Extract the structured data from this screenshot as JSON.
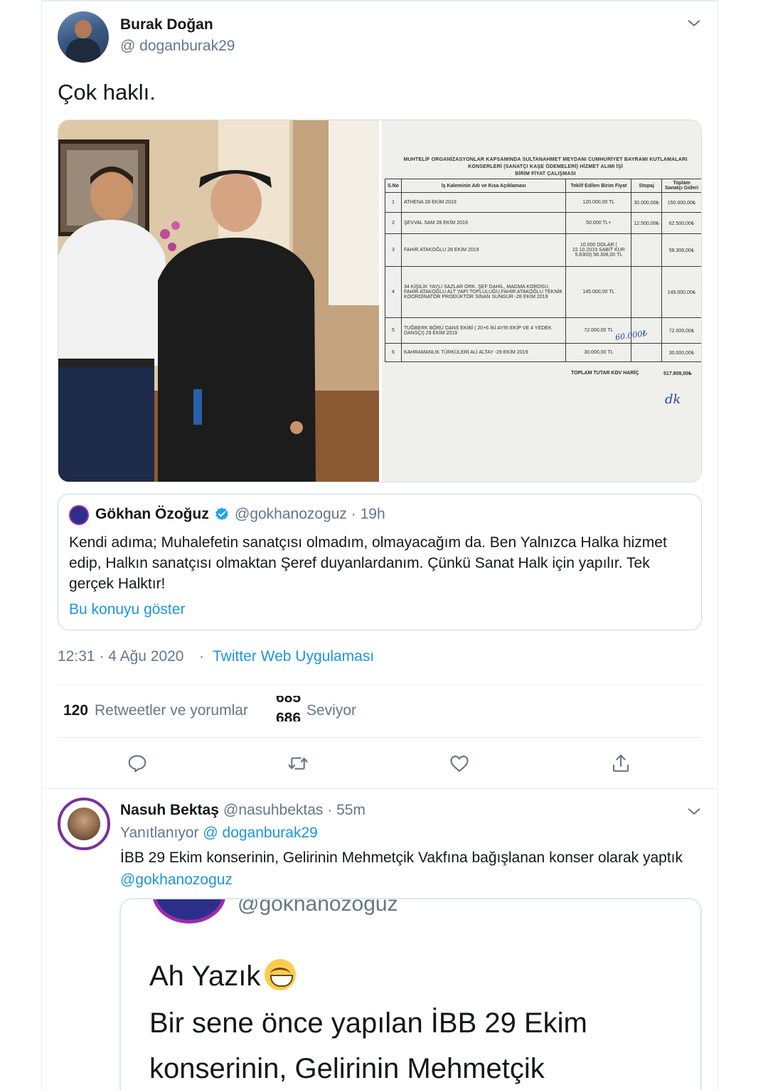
{
  "main_tweet": {
    "author_name": "Burak Doğan",
    "author_handle": "@ doganburak29",
    "text": "Çok haklı.",
    "timestamp": "12:31 · 4 Ağu 2020",
    "meta_separator": "·",
    "source": "Twitter Web Uygulaması"
  },
  "document": {
    "title_lines": [
      "MUHTELİF ORGANİZASYONLAR KAPSAMINDA SULTANAHMET MEYDANI CUMHURİYET BAYRAMI KUTLAMALARI",
      "KONSERLERİ (SANATÇI KAŞE ÖDEMELERİ) HİZMET ALIMI İŞİ",
      "BİRİM FİYAT ÇALIŞMASI"
    ],
    "headers": [
      "S.No",
      "İş Kaleminin Adı ve Kısa Açıklaması",
      "Teklif Edilen Birim Fiyat",
      "Stopaj",
      "Toplam Sanatçı Gideri"
    ],
    "rows": [
      {
        "no": "1",
        "desc": "ATHENA 28 EKİM 2019",
        "price": "120.000,00 TL",
        "stopaj": "30.000,00₺",
        "total": "150.000,00₺"
      },
      {
        "no": "2",
        "desc": "ŞEVVAL SAM 28 EKİM 2019",
        "price": "50.000 TL+",
        "stopaj": "12.500,00₺",
        "total": "62.500,00₺"
      },
      {
        "no": "3",
        "desc": "FAHİR ATAKOĞLU 28 EKİM 2019",
        "price": "10.000 DOLAR ( 22.10.2019 SABİT KUR 5.8303) 58.308,00 TL",
        "stopaj": "",
        "total": "58.308,00₺"
      },
      {
        "no": "4",
        "desc": "34 KİŞİLİK YAYLI SAZLAR ORK. ŞEF DAHİL, MAGMA KOROSU, FAHİR ATAKOĞLU ALT YAPI TOPLULUĞU,FAHİR ATAKOĞLU TEKNİK KOORDİNATÖR PRODÜKTÖR SİNAN SUNGUR -28 EKİM 2019",
        "price": "145.000,00 TL",
        "stopaj": "",
        "total": "145.000,00₺"
      },
      {
        "no": "5",
        "desc": "TUĞBERK BÖRÜ DANS EKİBİ ( 20+6 İKİ AYRI EKİP VE 4 YEDEK DANSÇI) 29 EKİM 2019",
        "price": "72.000,00 TL",
        "stopaj": "",
        "total": "72.000,00₺"
      },
      {
        "no": "6",
        "desc": "KAHRAMANLIK TÜRKÜLERİ ALİ ALTAY -29 EKİM 2019",
        "price": "30.000,00 TL",
        "stopaj": "",
        "total": "30.000,00₺"
      }
    ],
    "total_label": "TOPLAM TUTAR  KDV HARİÇ",
    "total_value": "517.808,00₺",
    "handwritten_note": "60.000₺",
    "signature": "dk"
  },
  "quoted_tweet": {
    "author_name": "Gökhan Özoğuz",
    "author_handle": "@gokhanozoguz · 19h",
    "text": "Kendi adıma; Muhalefetin sanatçısı olmadım, olmayacağım da. Ben Yalnızca Halka hizmet edip, Halkın sanatçısı olmaktan Şeref duyanlardanım. Çünkü Sanat Halk için yapılır. Tek gerçek Halktır!",
    "show_thread": "Bu konuyu göster"
  },
  "stats": {
    "retweets_count": "120",
    "retweets_label": "Retweetler ve yorumlar",
    "likes_prev": "685",
    "likes_count": "686",
    "likes_label": "Seviyor"
  },
  "actions": [
    "reply-icon",
    "retweet-icon",
    "like-icon",
    "share-icon"
  ],
  "reply": {
    "author_name": "Nasuh Bektaş",
    "author_handle": "@nasuhbektas · 55m",
    "replying_label": "Yanıtlanıyor",
    "replying_to": "@ doganburak29",
    "text": "İBB 29 Ekim konserinin, Gelirinin Mehmetçik Vakfına bağışlanan konser olarak yaptık",
    "mention": "@gokhanozoguz",
    "embedded": {
      "handle": "@gokhanozoguz",
      "line1": "Ah Yazık",
      "line2": "Bir sene önce yapılan İBB 29 Ekim",
      "line3": "konserinin, Gelirinin Mehmetçik"
    }
  },
  "colors": {
    "link": "#1b95e0",
    "secondary_text": "#657786",
    "border": "#e6ecf0",
    "verified": "#1da1f2"
  }
}
